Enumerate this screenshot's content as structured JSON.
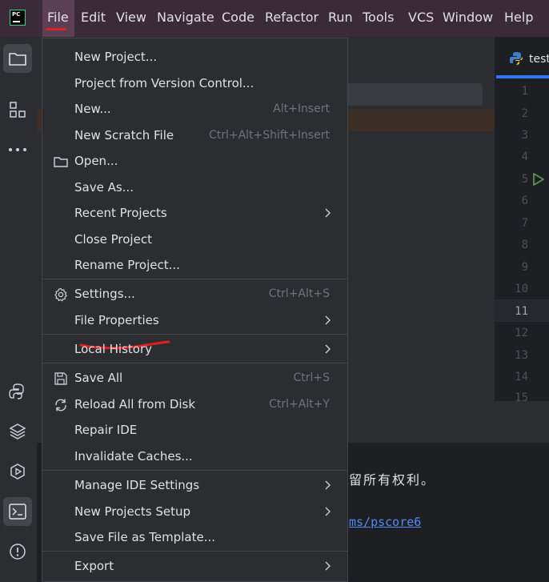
{
  "menubar": {
    "items": [
      {
        "label": "File"
      },
      {
        "label": "Edit"
      },
      {
        "label": "View"
      },
      {
        "label": "Navigate"
      },
      {
        "label": "Code"
      },
      {
        "label": "Refactor"
      },
      {
        "label": "Run"
      },
      {
        "label": "Tools"
      },
      {
        "label": "VCS"
      },
      {
        "label": "Window"
      },
      {
        "label": "Help"
      }
    ],
    "logo_text": "PC"
  },
  "editor": {
    "tab_label": "test",
    "line_numbers": [
      "1",
      "2",
      "3",
      "4",
      "5",
      "6",
      "7",
      "8",
      "9",
      "10",
      "11",
      "12",
      "13",
      "14",
      "15"
    ],
    "current_line": "11"
  },
  "terminal": {
    "line1": "留所有权利。",
    "link": "ms/pscore6"
  },
  "file_menu": {
    "items": [
      {
        "label": "New Project..."
      },
      {
        "label": "Project from Version Control..."
      },
      {
        "label": "New...",
        "shortcut": "Alt+Insert"
      },
      {
        "label": "New Scratch File",
        "shortcut": "Ctrl+Alt+Shift+Insert"
      },
      {
        "label": "Open..."
      },
      {
        "label": "Save As..."
      },
      {
        "label": "Recent Projects"
      },
      {
        "label": "Close Project"
      },
      {
        "label": "Rename Project..."
      },
      {
        "label": "Settings...",
        "shortcut": "Ctrl+Alt+S"
      },
      {
        "label": "File Properties"
      },
      {
        "label": "Local History"
      },
      {
        "label": "Save All",
        "shortcut": "Ctrl+S"
      },
      {
        "label": "Reload All from Disk",
        "shortcut": "Ctrl+Alt+Y"
      },
      {
        "label": "Repair IDE"
      },
      {
        "label": "Invalidate Caches..."
      },
      {
        "label": "Manage IDE Settings"
      },
      {
        "label": "New Projects Setup"
      },
      {
        "label": "Save File as Template..."
      },
      {
        "label": "Export"
      }
    ]
  },
  "colors": {
    "menubar_bg": "#3b2a37",
    "accent": "#3574f0",
    "annotation_red": "#e02020"
  }
}
